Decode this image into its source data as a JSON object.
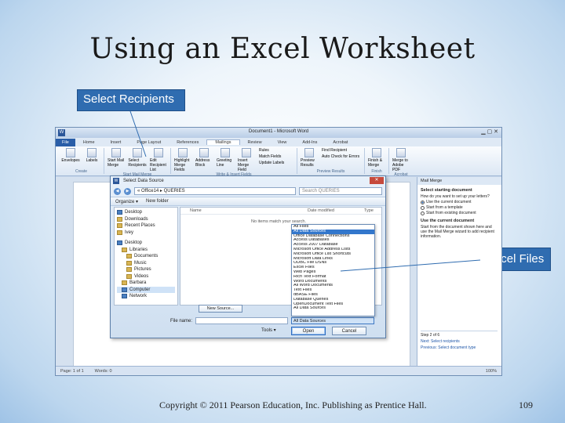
{
  "slide": {
    "title": "Using an Excel Worksheet",
    "callout_recipients": "Select Recipients",
    "callout_excel": "Excel Files",
    "footer": "Copyright © 2011 Pearson Education, Inc. Publishing as Prentice Hall.",
    "page_number": "109"
  },
  "word": {
    "window_title": "Document1 - Microsoft Word",
    "tabs": [
      "File",
      "Home",
      "Insert",
      "Page Layout",
      "References",
      "Mailings",
      "Review",
      "View",
      "Add-Ins",
      "Acrobat"
    ],
    "ribbon_groups": [
      {
        "label": "Create",
        "buttons": [
          "Envelopes",
          "Labels"
        ]
      },
      {
        "label": "Start Mail Merge",
        "buttons": [
          "Start Mail Merge",
          "Select Recipients",
          "Edit Recipient List"
        ]
      },
      {
        "label": "Write & Insert Fields",
        "buttons": [
          "Highlight Merge Fields",
          "Address Block",
          "Greeting Line",
          "Insert Merge Field"
        ]
      },
      {
        "label": "Preview Results",
        "buttons": [
          "Preview Results"
        ]
      },
      {
        "label": "Finish",
        "buttons": [
          "Finish & Merge"
        ]
      },
      {
        "label": "Acrobat",
        "buttons": [
          "Merge to Adobe PDF"
        ]
      }
    ],
    "ribbon_small": [
      "Rules",
      "Match Fields",
      "Update Labels",
      "Find Recipient",
      "Auto Check for Errors"
    ],
    "status": {
      "page": "Page: 1 of 1",
      "words": "Words: 0",
      "zoom": "100%"
    }
  },
  "pane": {
    "title": "Mail Merge",
    "section1": "Select starting document",
    "question": "How do you want to set up your letters?",
    "options": [
      "Use the current document",
      "Start from a template",
      "Start from existing document"
    ],
    "section2": "Use the current document",
    "description": "Start from the document shown here and use the Mail Merge wizard to add recipient information.",
    "step": "Step 2 of 6",
    "next": "Next: Select recipients",
    "previous": "Previous: Select document type"
  },
  "dialog": {
    "title": "Select Data Source",
    "path": "« Office14 ▸ QUERIES",
    "search_placeholder": "Search QUERIES",
    "organize": "Organize ▾",
    "new_folder": "New folder",
    "tree": [
      "Desktop",
      "Downloads",
      "Recent Places",
      "Ivey",
      "Desktop",
      "Libraries",
      "Documents",
      "Music",
      "Pictures",
      "Videos",
      "Barbara",
      "Computer",
      "Network"
    ],
    "columns": [
      "Name",
      "Date modified",
      "Type"
    ],
    "empty_message": "No items match your search.",
    "new_source": "New Source...",
    "file_name_label": "File name:",
    "file_type": "All Data Sources",
    "tools": "Tools ▾",
    "open": "Open",
    "cancel": "Cancel"
  },
  "dropdown": {
    "items": [
      "All Files",
      "All Data Sources",
      "Office Database Connections",
      "Access Databases",
      "Access 2007 Database",
      "Microsoft Office Address Lists",
      "Microsoft Office List Shortcuts",
      "Microsoft Data Links",
      "ODBC File DSNs",
      "Excel Files",
      "Web Pages",
      "Rich Text Format",
      "Word Documents",
      "All Word Documents",
      "Text Files",
      "dBASE Files",
      "Database Queries",
      "OpenDocument Text Files",
      "All Data Sources"
    ],
    "highlighted_index": 1
  }
}
